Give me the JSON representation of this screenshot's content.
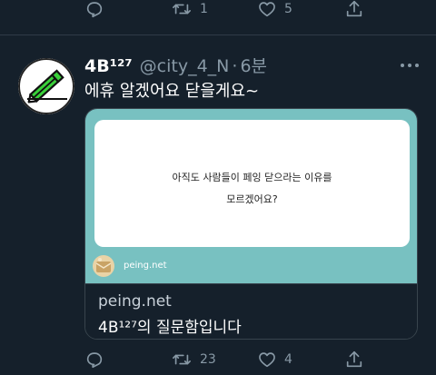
{
  "top_actions": {
    "reply_count": "",
    "retweet_count": "1",
    "like_count": "5"
  },
  "tweet": {
    "display_name": "4B¹²⁷",
    "handle": "@city_4_N",
    "separator": "·",
    "time": "6분",
    "text": "에휴 알겠어요 닫을게요~",
    "card": {
      "question_line1": "아직도 사람들이 페잉 닫으라는 이유를",
      "question_line2": "모르겠어요?",
      "site_label": "peing.net",
      "domain": "peing.net",
      "title": "4B¹²⁷의 질문함입니다",
      "image_color": "#78c1c1"
    },
    "actions": {
      "retweet_count": "23",
      "like_count": "4"
    }
  },
  "colors": {
    "background": "#15202b",
    "muted": "#8899a6",
    "accent_green": "#3ad13a"
  },
  "icons": [
    "reply-icon",
    "retweet-icon",
    "like-icon",
    "share-icon",
    "more-icon",
    "pencil-icon"
  ]
}
